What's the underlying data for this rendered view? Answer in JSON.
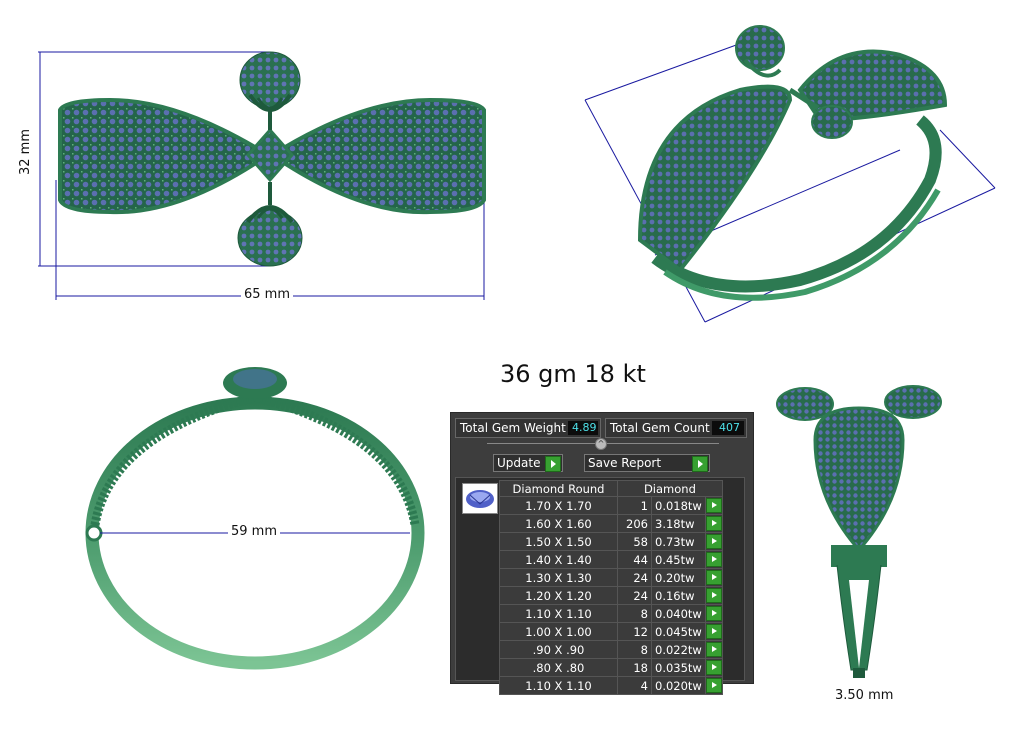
{
  "title": "36 gm 18 kt",
  "dimensions": {
    "height": "32 mm",
    "width": "65 mm",
    "inner_diameter": "59 mm",
    "band_width": "3.50 mm"
  },
  "colors": {
    "metal": "#2d7a52",
    "metal_light": "#6fbf8a",
    "gem": "#5b6fb0",
    "dimension_line": "#1a1aa0",
    "accent_value": "#4de0e8",
    "go_button": "#37a031"
  },
  "report": {
    "total_gem_weight_label": "Total Gem Weight",
    "total_gem_weight": "4.89",
    "total_gem_count_label": "Total Gem Count",
    "total_gem_count": "407",
    "update_label": "Update",
    "save_report_label": "Save Report",
    "gem_icon": "round-diamond-icon",
    "columns": [
      "Diamond Round",
      "Diamond"
    ],
    "rows": [
      {
        "size": "1.70 X 1.70",
        "count": "1",
        "weight": "0.018tw"
      },
      {
        "size": "1.60 X 1.60",
        "count": "206",
        "weight": "3.18tw"
      },
      {
        "size": "1.50 X 1.50",
        "count": "58",
        "weight": "0.73tw"
      },
      {
        "size": "1.40 X 1.40",
        "count": "44",
        "weight": "0.45tw"
      },
      {
        "size": "1.30 X 1.30",
        "count": "24",
        "weight": "0.20tw"
      },
      {
        "size": "1.20 X 1.20",
        "count": "24",
        "weight": "0.16tw"
      },
      {
        "size": "1.10 X 1.10",
        "count": "8",
        "weight": "0.040tw"
      },
      {
        "size": "1.00 X 1.00",
        "count": "12",
        "weight": "0.045tw"
      },
      {
        "size": ".90 X .90",
        "count": "8",
        "weight": "0.022tw"
      },
      {
        "size": ".80 X .80",
        "count": "18",
        "weight": "0.035tw"
      },
      {
        "size": "1.10 X 1.10",
        "count": "4",
        "weight": "0.020tw"
      }
    ]
  }
}
